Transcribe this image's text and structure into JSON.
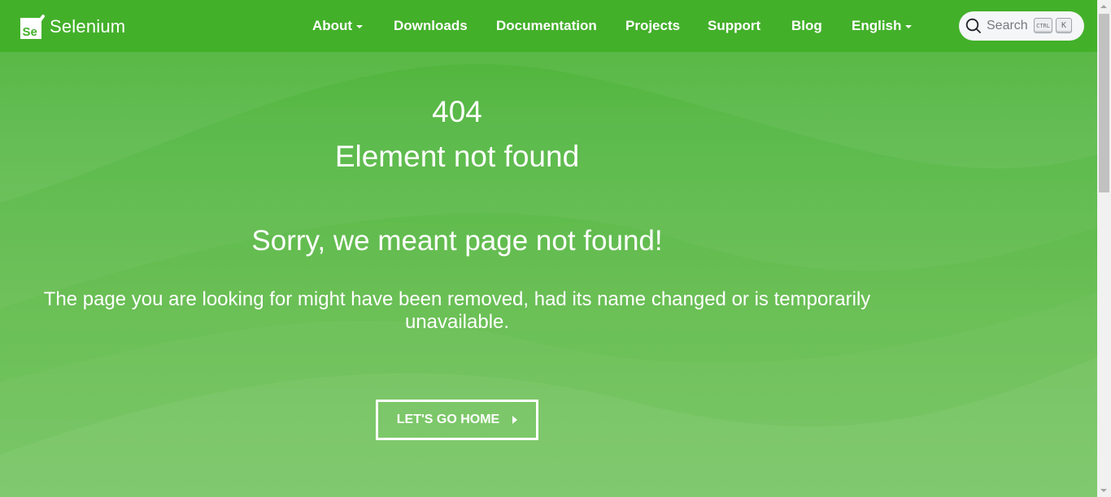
{
  "brand": {
    "name": "Selenium",
    "logo_icon": "selenium-logo-icon"
  },
  "nav": {
    "items": [
      {
        "label": "About",
        "has_dropdown": true
      },
      {
        "label": "Downloads",
        "has_dropdown": false
      },
      {
        "label": "Documentation",
        "has_dropdown": false
      },
      {
        "label": "Projects",
        "has_dropdown": false
      },
      {
        "label": "Support",
        "has_dropdown": false
      },
      {
        "label": "Blog",
        "has_dropdown": false
      },
      {
        "label": "English",
        "has_dropdown": true
      }
    ]
  },
  "search": {
    "placeholder": "Search",
    "shortcut_ctrl": "CTRL",
    "shortcut_key": "K",
    "icon": "search-icon"
  },
  "error": {
    "code": "404",
    "title": "Element not found",
    "subtitle": "Sorry, we meant page not found!",
    "message": "The page you are looking for might have been removed, had its name changed or is temporarily unavailable.",
    "home_button": "LET'S GO HOME"
  },
  "colors": {
    "navbar": "#43b02a",
    "background_top": "#43b02a",
    "background_bottom": "#76c663",
    "text": "#ffffff",
    "search_bg": "#f4f6f8"
  }
}
